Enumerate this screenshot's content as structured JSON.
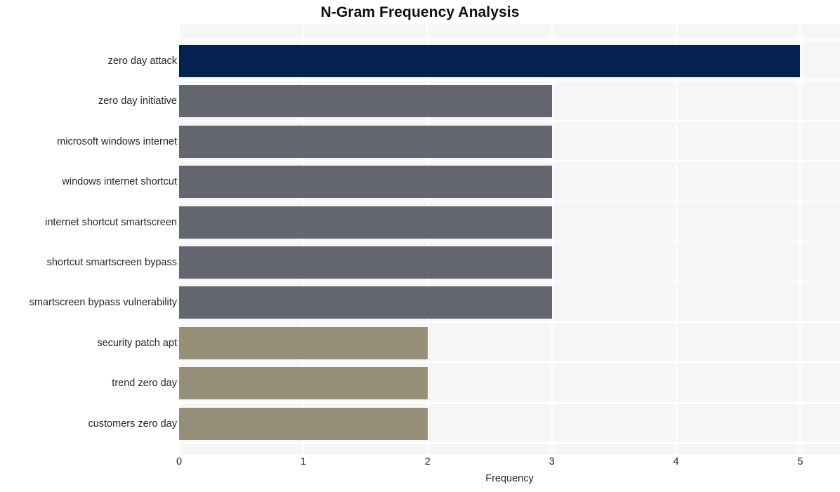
{
  "chart_data": {
    "type": "bar",
    "orientation": "horizontal",
    "title": "N-Gram Frequency Analysis",
    "xlabel": "Frequency",
    "ylabel": "",
    "categories": [
      "zero day attack",
      "zero day initiative",
      "microsoft windows internet",
      "windows internet shortcut",
      "internet shortcut smartscreen",
      "shortcut smartscreen bypass",
      "smartscreen bypass vulnerability",
      "security patch apt",
      "trend zero day",
      "customers zero day"
    ],
    "values": [
      5,
      3,
      3,
      3,
      3,
      3,
      3,
      2,
      2,
      2
    ],
    "bar_colors": [
      "#032250",
      "#64676f",
      "#64676f",
      "#64676f",
      "#64676f",
      "#64676f",
      "#64676f",
      "#968f78",
      "#968f78",
      "#968f78"
    ],
    "xlim": [
      0,
      5.32
    ],
    "x_ticks": [
      0,
      1,
      2,
      3,
      4,
      5
    ],
    "x_tick_labels": [
      "0",
      "1",
      "2",
      "3",
      "4",
      "5"
    ],
    "grid": true,
    "grid_color": "#ffffff",
    "plot_background": "#f6f6f7",
    "figure_background": "#ffffff",
    "legend": null,
    "legend_position": "none"
  },
  "theme": {
    "title_color": "#0f0f0f",
    "tick_color": "#262626",
    "accent_primary": "#032250",
    "accent_secondary": "#64676f",
    "accent_tertiary": "#968f78"
  }
}
